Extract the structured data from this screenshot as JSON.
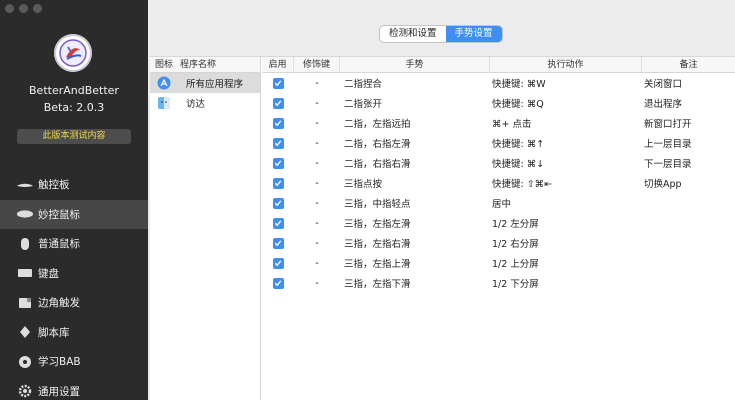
{
  "sidebar": {
    "app_name": "BetterAndBetter",
    "version": "Beta: 2.0.3",
    "beta_button": "此版本测试内容",
    "items": [
      {
        "label": "触控板",
        "icon": "trackpad-icon"
      },
      {
        "label": "妙控鼠标",
        "icon": "magic-mouse-icon",
        "active": true
      },
      {
        "label": "普通鼠标",
        "icon": "mouse-icon"
      },
      {
        "label": "键盘",
        "icon": "keyboard-icon"
      },
      {
        "label": "边角触发",
        "icon": "corner-icon"
      },
      {
        "label": "脚本库",
        "icon": "script-icon"
      },
      {
        "label": "学习BAB",
        "icon": "learn-icon"
      },
      {
        "label": "通用设置",
        "icon": "gear-icon"
      }
    ]
  },
  "tabs": [
    "检测和设置",
    "手势设置"
  ],
  "active_tab": 1,
  "app_list": {
    "headers": [
      "图标",
      "程序名称"
    ],
    "rows": [
      {
        "name": "所有应用程序",
        "icon": "app-store-icon"
      },
      {
        "name": "访达",
        "icon": "finder-icon"
      }
    ]
  },
  "gesture_table": {
    "headers": [
      "启用",
      "修饰键",
      "手势",
      "执行动作",
      "备注"
    ],
    "rows": [
      {
        "mod": "-",
        "gesture": "二指捏合",
        "action": "快捷键: ⌘W",
        "note": "关闭窗口"
      },
      {
        "mod": "-",
        "gesture": "二指张开",
        "action": "快捷键: ⌘Q",
        "note": "退出程序"
      },
      {
        "mod": "-",
        "gesture": "二指，左指远拍",
        "action": "⌘+ 点击",
        "note": "新窗口打开"
      },
      {
        "mod": "-",
        "gesture": "二指，右指左滑",
        "action": "快捷键: ⌘↑",
        "note": "上一层目录"
      },
      {
        "mod": "-",
        "gesture": "二指，右指右滑",
        "action": "快捷键: ⌘↓",
        "note": "下一层目录"
      },
      {
        "mod": "-",
        "gesture": "三指点按",
        "action": "快捷键: ⇧⌘⇤",
        "note": "切换App"
      },
      {
        "mod": "-",
        "gesture": "三指，中指轻点",
        "action": "居中",
        "note": ""
      },
      {
        "mod": "-",
        "gesture": "三指，左指左滑",
        "action": "1/2 左分屏",
        "note": ""
      },
      {
        "mod": "-",
        "gesture": "三指，左指右滑",
        "action": "1/2 右分屏",
        "note": ""
      },
      {
        "mod": "-",
        "gesture": "三指，左指上滑",
        "action": "1/2 上分屏",
        "note": ""
      },
      {
        "mod": "-",
        "gesture": "三指，左指下滑",
        "action": "1/2 下分屏",
        "note": ""
      }
    ]
  },
  "colors": {
    "accent": "#3d8ff2",
    "sidebar": "#2b2b2b",
    "beta_text": "#e9d64a"
  }
}
